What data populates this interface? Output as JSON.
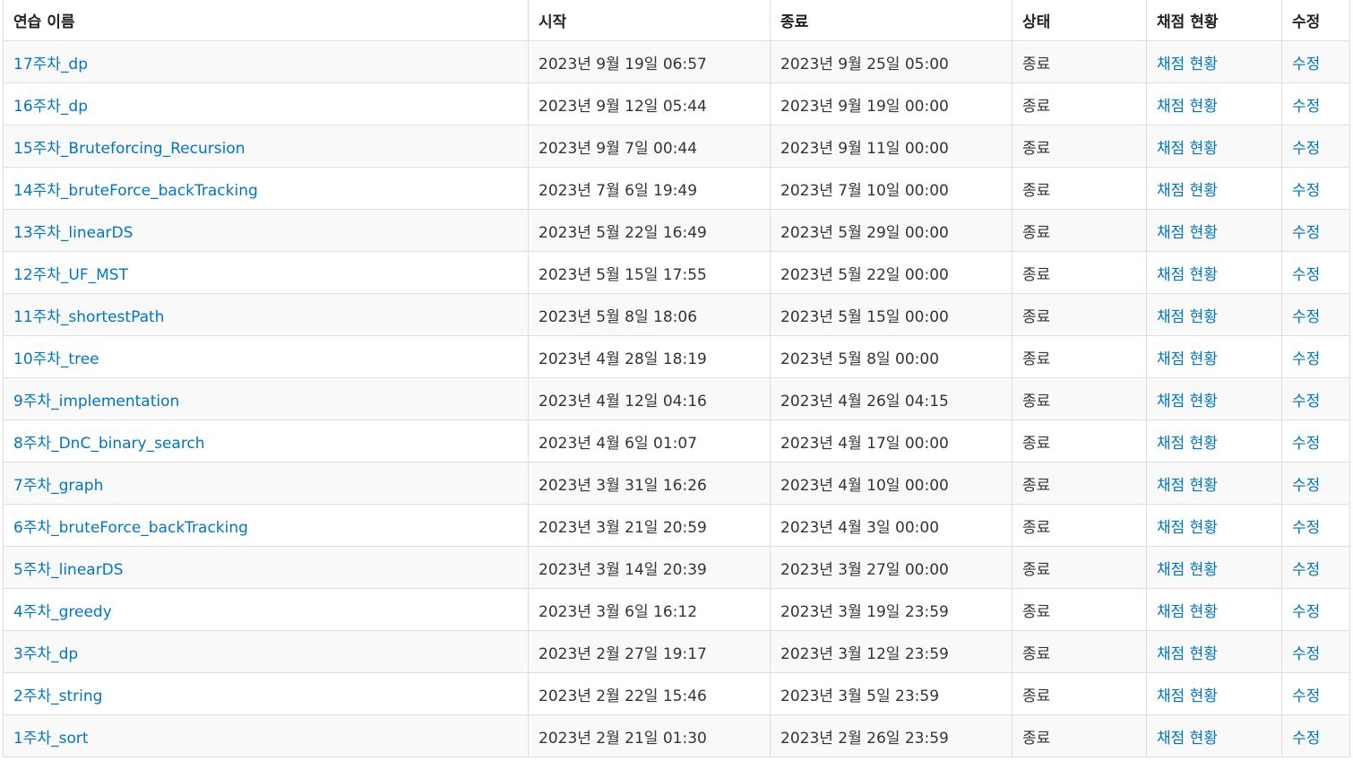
{
  "table": {
    "headers": {
      "name": "연습 이름",
      "start": "시작",
      "end": "종료",
      "status": "상태",
      "grading": "채점 현황",
      "edit": "수정"
    },
    "rows": [
      {
        "name": "17주차_dp",
        "start": "2023년 9월 19일 06:57",
        "end": "2023년 9월 25일 05:00",
        "status": "종료",
        "grading": "채점 현황",
        "edit": "수정"
      },
      {
        "name": "16주차_dp",
        "start": "2023년 9월 12일 05:44",
        "end": "2023년 9월 19일 00:00",
        "status": "종료",
        "grading": "채점 현황",
        "edit": "수정"
      },
      {
        "name": "15주차_Bruteforcing_Recursion",
        "start": "2023년 9월 7일 00:44",
        "end": "2023년 9월 11일 00:00",
        "status": "종료",
        "grading": "채점 현황",
        "edit": "수정"
      },
      {
        "name": "14주차_bruteForce_backTracking",
        "start": "2023년 7월 6일 19:49",
        "end": "2023년 7월 10일 00:00",
        "status": "종료",
        "grading": "채점 현황",
        "edit": "수정"
      },
      {
        "name": "13주차_linearDS",
        "start": "2023년 5월 22일 16:49",
        "end": "2023년 5월 29일 00:00",
        "status": "종료",
        "grading": "채점 현황",
        "edit": "수정"
      },
      {
        "name": "12주차_UF_MST",
        "start": "2023년 5월 15일 17:55",
        "end": "2023년 5월 22일 00:00",
        "status": "종료",
        "grading": "채점 현황",
        "edit": "수정"
      },
      {
        "name": "11주차_shortestPath",
        "start": "2023년 5월 8일 18:06",
        "end": "2023년 5월 15일 00:00",
        "status": "종료",
        "grading": "채점 현황",
        "edit": "수정"
      },
      {
        "name": "10주차_tree",
        "start": "2023년 4월 28일 18:19",
        "end": "2023년 5월 8일 00:00",
        "status": "종료",
        "grading": "채점 현황",
        "edit": "수정"
      },
      {
        "name": "9주차_implementation",
        "start": "2023년 4월 12일 04:16",
        "end": "2023년 4월 26일 04:15",
        "status": "종료",
        "grading": "채점 현황",
        "edit": "수정"
      },
      {
        "name": "8주차_DnC_binary_search",
        "start": "2023년 4월 6일 01:07",
        "end": "2023년 4월 17일 00:00",
        "status": "종료",
        "grading": "채점 현황",
        "edit": "수정"
      },
      {
        "name": "7주차_graph",
        "start": "2023년 3월 31일 16:26",
        "end": "2023년 4월 10일 00:00",
        "status": "종료",
        "grading": "채점 현황",
        "edit": "수정"
      },
      {
        "name": "6주차_bruteForce_backTracking",
        "start": "2023년 3월 21일 20:59",
        "end": "2023년 4월 3일 00:00",
        "status": "종료",
        "grading": "채점 현황",
        "edit": "수정"
      },
      {
        "name": "5주차_linearDS",
        "start": "2023년 3월 14일 20:39",
        "end": "2023년 3월 27일 00:00",
        "status": "종료",
        "grading": "채점 현황",
        "edit": "수정"
      },
      {
        "name": "4주차_greedy",
        "start": "2023년 3월 6일 16:12",
        "end": "2023년 3월 19일 23:59",
        "status": "종료",
        "grading": "채점 현황",
        "edit": "수정"
      },
      {
        "name": "3주차_dp",
        "start": "2023년 2월 27일 19:17",
        "end": "2023년 3월 12일 23:59",
        "status": "종료",
        "grading": "채점 현황",
        "edit": "수정"
      },
      {
        "name": "2주차_string",
        "start": "2023년 2월 22일 15:46",
        "end": "2023년 3월 5일 23:59",
        "status": "종료",
        "grading": "채점 현황",
        "edit": "수정"
      },
      {
        "name": "1주차_sort",
        "start": "2023년 2월 21일 01:30",
        "end": "2023년 2월 26일 23:59",
        "status": "종료",
        "grading": "채점 현황",
        "edit": "수정"
      }
    ]
  }
}
